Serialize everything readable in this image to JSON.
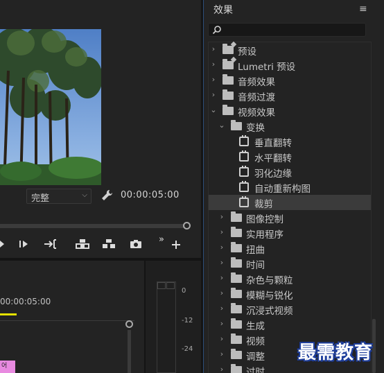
{
  "monitor": {
    "fit_value": "完整",
    "timecode": "00:00:05:00"
  },
  "timeline": {
    "ruler_time": "00:00:05:00",
    "clip_label": "어"
  },
  "audio_meter": {
    "labels": [
      "0",
      "-12",
      "-24"
    ]
  },
  "effects": {
    "title": "效果",
    "menu_icon": "hamburger-icon",
    "search_placeholder": "",
    "items": [
      {
        "label": "预设",
        "level": 0,
        "expanded": false,
        "kind": "folder-star"
      },
      {
        "label": "Lumetri 预设",
        "level": 0,
        "expanded": false,
        "kind": "folder-star"
      },
      {
        "label": "音频效果",
        "level": 0,
        "expanded": false,
        "kind": "folder"
      },
      {
        "label": "音频过渡",
        "level": 0,
        "expanded": false,
        "kind": "folder"
      },
      {
        "label": "视频效果",
        "level": 0,
        "expanded": true,
        "kind": "folder"
      },
      {
        "label": "变换",
        "level": 1,
        "expanded": true,
        "kind": "folder"
      },
      {
        "label": "垂直翻转",
        "level": 2,
        "kind": "effect"
      },
      {
        "label": "水平翻转",
        "level": 2,
        "kind": "effect"
      },
      {
        "label": "羽化边缘",
        "level": 2,
        "kind": "effect"
      },
      {
        "label": "自动重新构图",
        "level": 2,
        "kind": "effect"
      },
      {
        "label": "裁剪",
        "level": 2,
        "kind": "effect",
        "selected": true
      },
      {
        "label": "图像控制",
        "level": 1,
        "expanded": false,
        "kind": "folder"
      },
      {
        "label": "实用程序",
        "level": 1,
        "expanded": false,
        "kind": "folder"
      },
      {
        "label": "扭曲",
        "level": 1,
        "expanded": false,
        "kind": "folder"
      },
      {
        "label": "时间",
        "level": 1,
        "expanded": false,
        "kind": "folder"
      },
      {
        "label": "杂色与颗粒",
        "level": 1,
        "expanded": false,
        "kind": "folder"
      },
      {
        "label": "模糊与锐化",
        "level": 1,
        "expanded": false,
        "kind": "folder"
      },
      {
        "label": "沉浸式视频",
        "level": 1,
        "expanded": false,
        "kind": "folder"
      },
      {
        "label": "生成",
        "level": 1,
        "expanded": false,
        "kind": "folder"
      },
      {
        "label": "视频",
        "level": 1,
        "expanded": false,
        "kind": "folder"
      },
      {
        "label": "调整",
        "level": 1,
        "expanded": false,
        "kind": "folder"
      },
      {
        "label": "过时",
        "level": 1,
        "expanded": false,
        "kind": "folder"
      }
    ]
  },
  "watermark": "最需教育",
  "colors": {
    "panel_bg": "#232323",
    "selected_row": "#3b3b3b",
    "playhead": "#e5e200",
    "clip": "#e88ae0",
    "focus_border": "#2d4f7a",
    "watermark_outline": "#1e3e9c"
  }
}
